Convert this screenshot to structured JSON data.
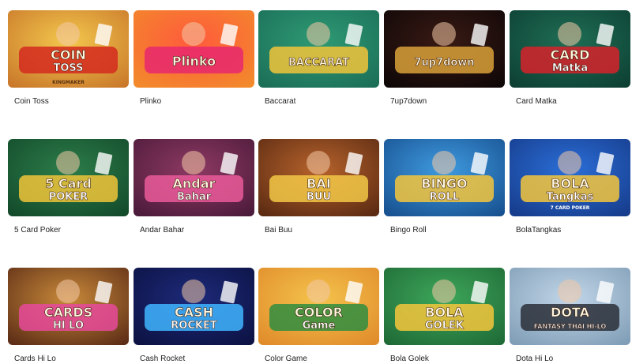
{
  "games": [
    {
      "title": "Coin Toss",
      "art": {
        "line1": "COIN",
        "line2": "TOSS",
        "brand": "KINGMAKER"
      },
      "colors": {
        "bg1": "#f3c84d",
        "bg2": "#c9772a",
        "accent": "#d42a1f"
      }
    },
    {
      "title": "Plinko",
      "art": {
        "line1": "Plinko"
      },
      "colors": {
        "bg1": "#ff5a3c",
        "bg2": "#f28b2b",
        "accent": "#e8286f"
      }
    },
    {
      "title": "Baccarat",
      "art": {
        "line1": "BACCARAT"
      },
      "colors": {
        "bg1": "#2e9a74",
        "bg2": "#1b6e57",
        "accent": "#f1c43a"
      }
    },
    {
      "title": "7up7down",
      "art": {
        "line1": "7up7down"
      },
      "colors": {
        "bg1": "#3a1a14",
        "bg2": "#0e0707",
        "accent": "#d9a13a"
      }
    },
    {
      "title": "Card Matka",
      "art": {
        "line1": "CARD",
        "line2": "Matka"
      },
      "colors": {
        "bg1": "#1f6e55",
        "bg2": "#0d3f32",
        "accent": "#d6222a"
      }
    },
    {
      "title": "5 Card Poker",
      "art": {
        "line1": "5 Card",
        "line2": "POKER"
      },
      "colors": {
        "bg1": "#2c7d4a",
        "bg2": "#134a2a",
        "accent": "#f0c43a"
      }
    },
    {
      "title": "Andar Bahar",
      "art": {
        "line1": "Andar",
        "line2": "Bahar"
      },
      "colors": {
        "bg1": "#8e3a63",
        "bg2": "#4b1a3a",
        "accent": "#ea5a9a"
      }
    },
    {
      "title": "Bai Buu",
      "art": {
        "line1": "BAI",
        "line2": "BUU"
      },
      "colors": {
        "bg1": "#b7632c",
        "bg2": "#5a2a12",
        "accent": "#f2c847"
      }
    },
    {
      "title": "Bingo Roll",
      "art": {
        "line1": "BINGO",
        "line2": "ROLL"
      },
      "colors": {
        "bg1": "#3f9be0",
        "bg2": "#17508f",
        "accent": "#f4c63c"
      }
    },
    {
      "title": "BolaTangkas",
      "art": {
        "line1": "BOLA",
        "line2": "Tangkas",
        "line3": "7 CARD POKER"
      },
      "colors": {
        "bg1": "#2b6fd8",
        "bg2": "#163b8a",
        "accent": "#f4c63c"
      }
    },
    {
      "title": "Cards Hi Lo",
      "art": {
        "line1": "CARDS",
        "line2": "HI LO"
      },
      "colors": {
        "bg1": "#c98a3a",
        "bg2": "#5b2c16",
        "accent": "#e64a9a"
      }
    },
    {
      "title": "Cash Rocket",
      "art": {
        "line1": "CASH",
        "line2": "ROCKET"
      },
      "colors": {
        "bg1": "#1d2a7a",
        "bg2": "#0c1242",
        "accent": "#3fb5ff"
      }
    },
    {
      "title": "Color Game",
      "art": {
        "line1": "COLOR",
        "line2": "Game"
      },
      "colors": {
        "bg1": "#f4c34c",
        "bg2": "#e08b2a",
        "accent": "#2f8d3f"
      }
    },
    {
      "title": "Bola Golek",
      "art": {
        "line1": "BOLA",
        "line2": "GOLEK"
      },
      "colors": {
        "bg1": "#3da75a",
        "bg2": "#1f6a36",
        "accent": "#f4c63c"
      }
    },
    {
      "title": "Dota Hi Lo",
      "art": {
        "line1": "DOTA",
        "line2": "FANTASY THAI HI-LO"
      },
      "colors": {
        "bg1": "#c2d6e8",
        "bg2": "#7f9db6",
        "accent": "#2a2f38"
      }
    }
  ]
}
